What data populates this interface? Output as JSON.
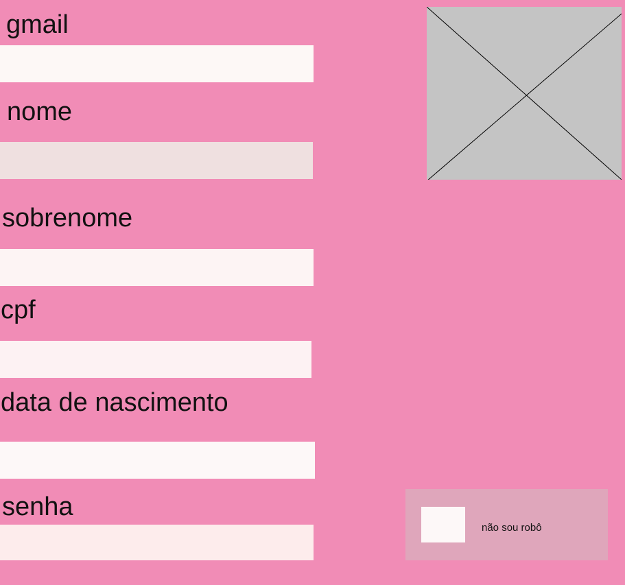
{
  "form": {
    "gmail": {
      "label": "gmail",
      "value": "",
      "bg": "#fdf8f6"
    },
    "nome": {
      "label": "nome",
      "value": "",
      "bg": "#efe0e0"
    },
    "sobrenome": {
      "label": "sobrenome",
      "value": "",
      "bg": "#fdf4f4"
    },
    "cpf": {
      "label": "cpf",
      "value": "",
      "bg": "#fdf2f3"
    },
    "data_nascimento": {
      "label": "data de nascimento",
      "value": "",
      "bg": "#fdf8f8"
    },
    "senha": {
      "label": "senha",
      "value": "",
      "bg": "#fdecec"
    }
  },
  "image_placeholder": {
    "icon": "image-placeholder-icon",
    "fill": "#c4c4c4"
  },
  "captcha": {
    "label": "não sou robô",
    "checked": false
  },
  "colors": {
    "background": "#f18cb6",
    "captcha_panel": "#dfa6bb",
    "text": "#111111"
  }
}
